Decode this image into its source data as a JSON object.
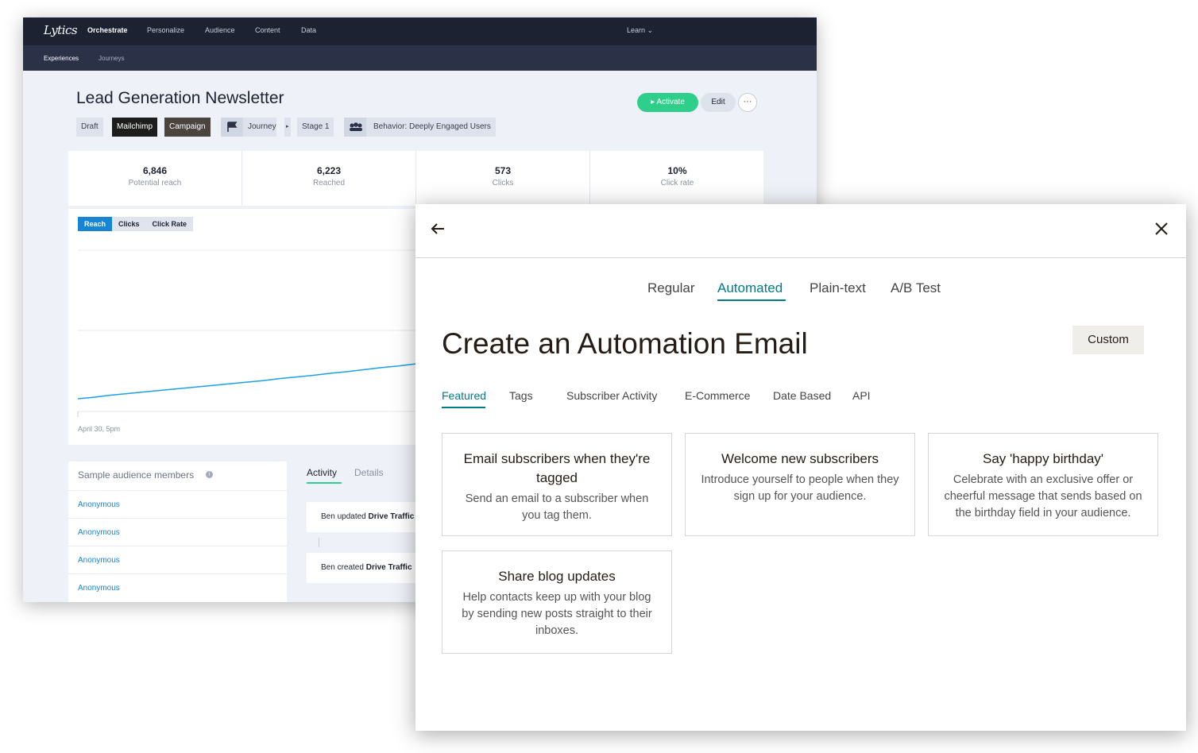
{
  "back_window": {
    "logo": "Lytics",
    "nav": {
      "items": [
        "Orchestrate",
        "Personalize",
        "Audience",
        "Content",
        "Data"
      ],
      "learn": "Learn ⌄"
    },
    "subnav": {
      "items": [
        "Experiences",
        "Journeys"
      ]
    },
    "page_title": "Lead Generation Newsletter",
    "tags": {
      "draft": "Draft",
      "mailchimp": "Mailchimp",
      "campaign": "Campaign",
      "journey": "Journey",
      "stage": "Stage 1",
      "behavior": "Behavior: Deeply Engaged Users"
    },
    "buttons": {
      "activate": "▸ Activate",
      "edit": "Edit",
      "more": "···"
    },
    "stats": [
      {
        "value": "6,846",
        "label": "Potential reach"
      },
      {
        "value": "6,223",
        "label": "Reached"
      },
      {
        "value": "573",
        "label": "Clicks"
      },
      {
        "value": "10%",
        "label": "Click rate"
      }
    ],
    "chart_tabs": [
      "Reach",
      "Clicks",
      "Click Rate"
    ],
    "chart_xlabel": "April 30, 5pm",
    "audience": {
      "title": "Sample audience members",
      "info_icon": "i",
      "members": [
        "Anonymous",
        "Anonymous",
        "Anonymous",
        "Anonymous"
      ]
    },
    "activity": {
      "tabs": [
        "Activity",
        "Details"
      ],
      "items": [
        {
          "prefix": "Ben updated ",
          "bold": "Drive Traffic"
        },
        {
          "prefix": "Ben created ",
          "bold": "Drive Traffic"
        }
      ]
    }
  },
  "chart_data": {
    "type": "line",
    "series": [
      {
        "values": [
          0.0,
          0.04,
          0.09,
          0.13,
          0.17,
          0.21,
          0.25,
          0.29,
          0.33,
          0.37,
          0.41,
          0.45,
          0.5,
          0.54,
          0.58,
          0.63,
          0.67,
          0.72,
          0.77,
          0.81,
          0.86
        ]
      }
    ],
    "xlabel": "",
    "ylabel": "",
    "x_tick_labels": [
      "April 30, 5pm"
    ],
    "grid": true,
    "color": "#1da1e6"
  },
  "modal": {
    "tabs": [
      "Regular",
      "Automated",
      "Plain-text",
      "A/B Test"
    ],
    "title": "Create an Automation Email",
    "custom_button": "Custom",
    "filter_tabs": [
      "Featured",
      "Tags",
      "Subscriber Activity",
      "E-Commerce",
      "Date Based",
      "API"
    ],
    "cards": [
      {
        "title": "Email subscribers when they're tagged",
        "desc": "Send an email to a subscriber when you tag them."
      },
      {
        "title": "Welcome new subscribers",
        "desc": "Introduce yourself to people when they sign up for your audience."
      },
      {
        "title": "Say 'happy birthday'",
        "desc": "Celebrate with an exclusive offer or cheerful message that sends based on the birthday field in your audience."
      },
      {
        "title": "Share blog updates",
        "desc": "Help contacts keep up with your blog by sending new posts straight to their inboxes."
      }
    ],
    "accent_color": "#007c89"
  }
}
